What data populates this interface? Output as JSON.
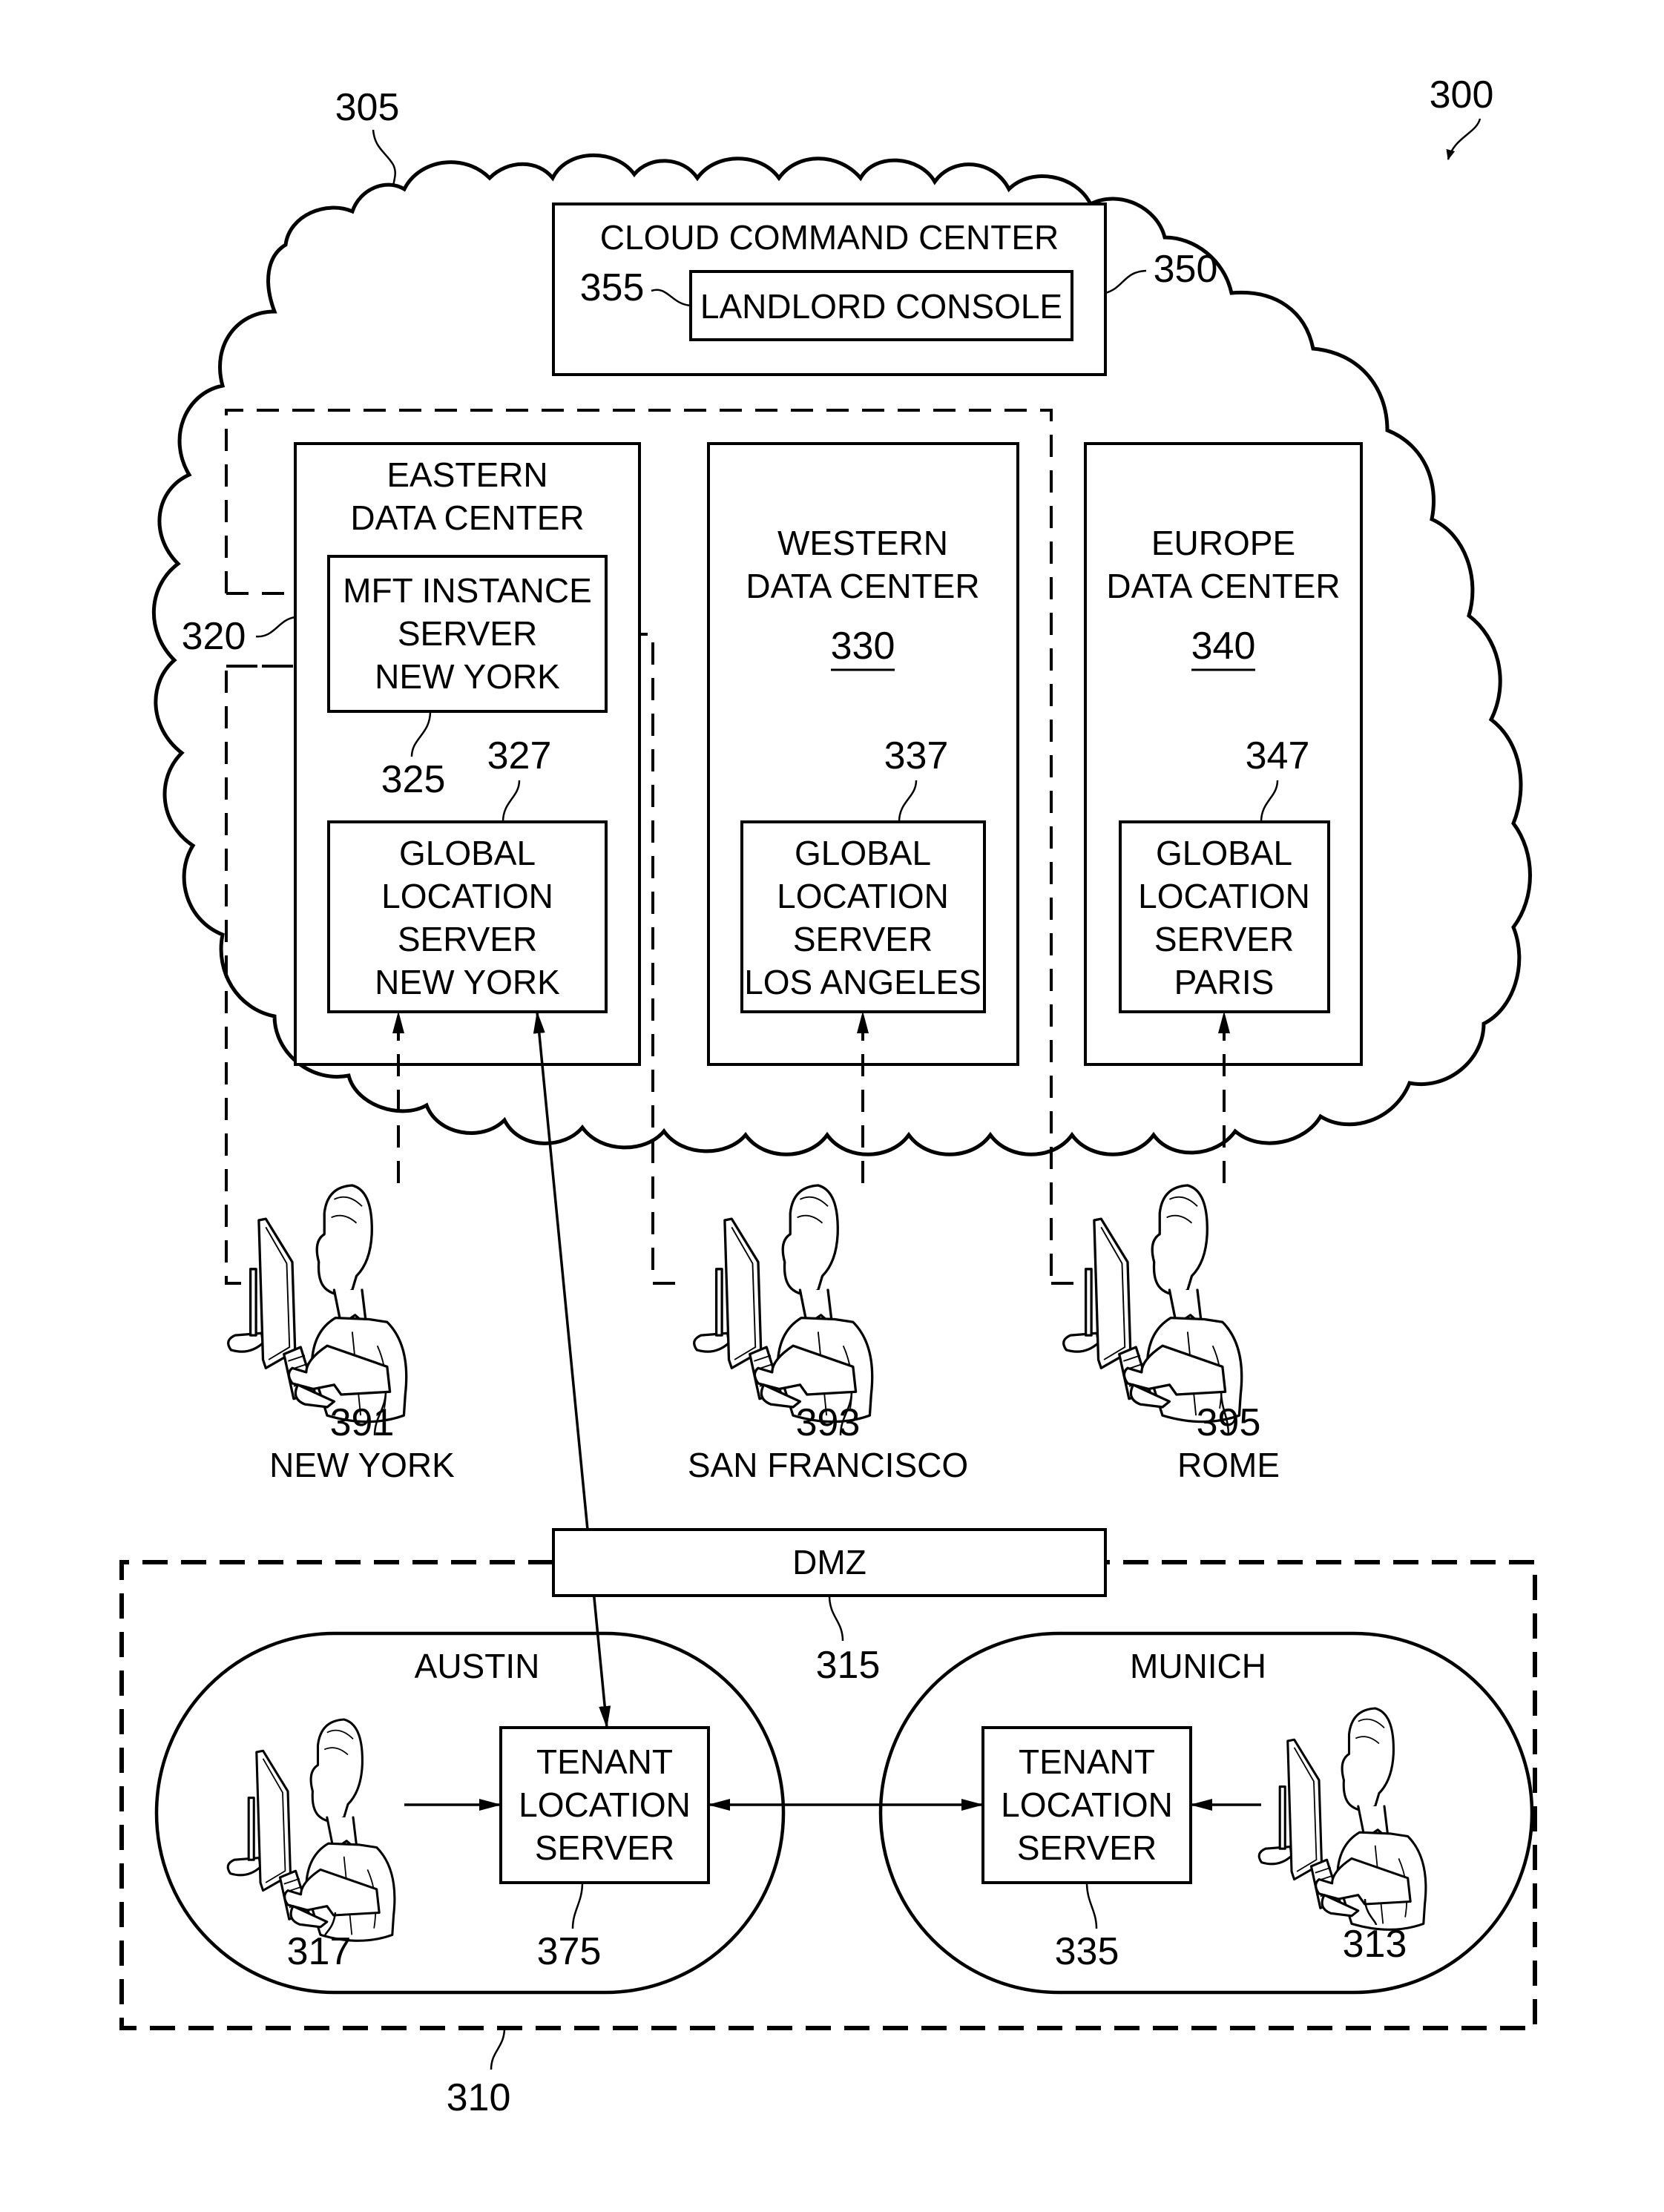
{
  "figure": {
    "ref": "300",
    "cloud_ref": "305",
    "tenant_network_ref": "310",
    "dmz_ref": "315",
    "mft_group_ref": "320"
  },
  "cloud_command_center": {
    "title": "CLOUD COMMAND CENTER",
    "ref": "350",
    "landlord_console": {
      "label": "LANDLORD CONSOLE",
      "ref": "355"
    }
  },
  "data_centers": [
    {
      "title_lines": [
        "EASTERN",
        "DATA CENTER"
      ],
      "ref": "",
      "mft": {
        "lines": [
          "MFT INSTANCE",
          "SERVER",
          "NEW YORK"
        ],
        "ref": "325"
      },
      "gls": {
        "lines": [
          "GLOBAL",
          "LOCATION",
          "SERVER",
          "NEW YORK"
        ],
        "ref": "327"
      }
    },
    {
      "title_lines": [
        "WESTERN",
        "DATA CENTER"
      ],
      "ref": "330",
      "gls": {
        "lines": [
          "GLOBAL",
          "LOCATION",
          "SERVER",
          "LOS ANGELES"
        ],
        "ref": "337"
      }
    },
    {
      "title_lines": [
        "EUROPE",
        "DATA CENTER"
      ],
      "ref": "340",
      "gls": {
        "lines": [
          "GLOBAL",
          "LOCATION",
          "SERVER",
          "PARIS"
        ],
        "ref": "347"
      }
    }
  ],
  "users": [
    {
      "ref": "391",
      "city": "NEW YORK"
    },
    {
      "ref": "393",
      "city": "SAN FRANCISCO"
    },
    {
      "ref": "395",
      "city": "ROME"
    }
  ],
  "dmz": {
    "label": "DMZ"
  },
  "tenant_sites": [
    {
      "name": "AUSTIN",
      "server_lines": [
        "TENANT",
        "LOCATION",
        "SERVER"
      ],
      "server_ref": "375",
      "user_ref": "317"
    },
    {
      "name": "MUNICH",
      "server_lines": [
        "TENANT",
        "LOCATION",
        "SERVER"
      ],
      "server_ref": "335",
      "user_ref": "313"
    }
  ]
}
